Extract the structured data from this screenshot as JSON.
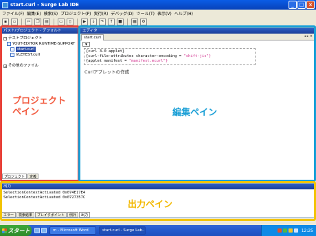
{
  "window": {
    "title": "start.curl - Surge Lab IDE"
  },
  "menu": [
    "ファイル(F)",
    "編集(E)",
    "検索(S)",
    "プロジェクト(P)",
    "実行(R)",
    "デバッグ(D)",
    "ツール(T)",
    "表示(V)",
    "ヘルプ(H)"
  ],
  "project_pane": {
    "header": "パスト/プロジェクト - デフォルト",
    "tree": [
      "テストプロジェクト",
      "YOUT-EDITOR RUNTIME-SUPPORT",
      "start.curl",
      "VLETEST.curl",
      "その他のファイル"
    ],
    "tabs": [
      "プロジェクト",
      "定義"
    ]
  },
  "editor_pane": {
    "header": "エディタ",
    "tab": "start.curl",
    "code": {
      "line1": "{curl 3.0 applet}",
      "line2_a": "{curl-file-attributes character-encoding = ",
      "line2_b": "\"shift-jis\"}",
      "line3_a": "{applet manifest = ",
      "line3_b": "\"manifest.mcurl\"}"
    },
    "note": "Curlアプレットの作成"
  },
  "output_pane": {
    "header": "出力",
    "lines": [
      "SelectionContextActivated 0x074E17E4",
      "SelectionContextActivated 0x0727357C"
    ],
    "tabs": [
      "エラー",
      "検索結果",
      "ブレイクポイント",
      "例外",
      "出力"
    ]
  },
  "annotations": {
    "project_line1": "プロジェクト",
    "project_line2": "ペイン",
    "editor": "編集ペイン",
    "output": "出力ペイン"
  },
  "taskbar": {
    "start": "スタート",
    "items": [
      "m - Microsoft Word",
      "start.curl - Surge Lab..."
    ],
    "time": "12:25"
  }
}
